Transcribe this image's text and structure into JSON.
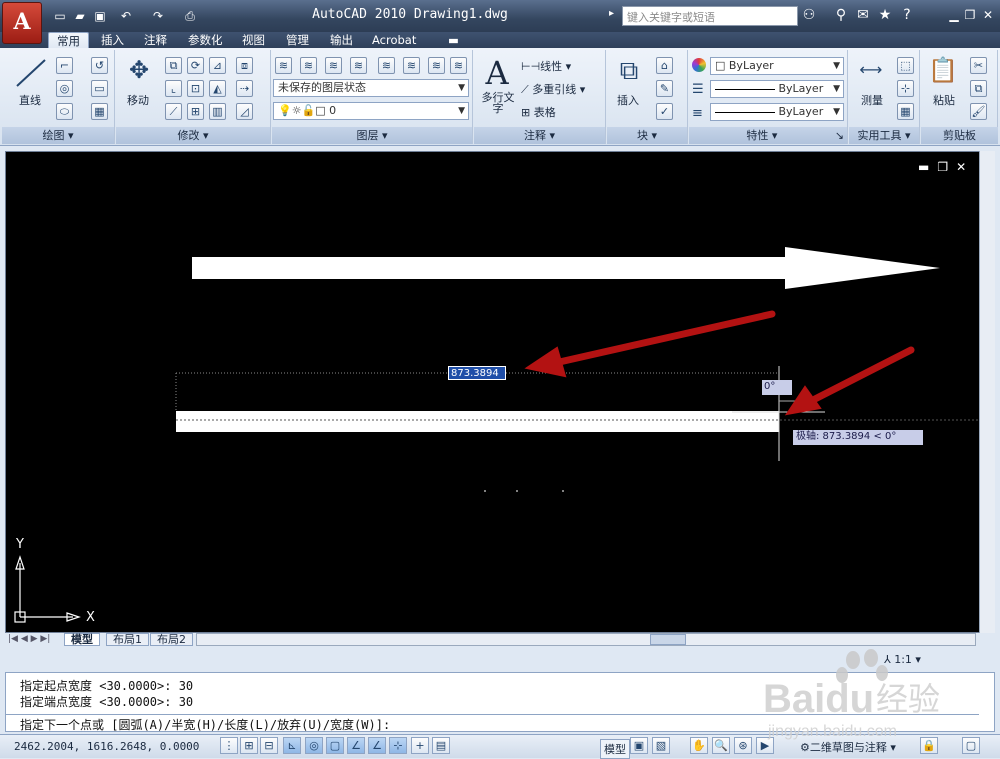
{
  "app": {
    "title": "AutoCAD 2010   Drawing1.dwg",
    "logo_letter": "A",
    "search_placeholder": "键入关键字或短语"
  },
  "tabs": [
    "常用",
    "插入",
    "注释",
    "参数化",
    "视图",
    "管理",
    "输出",
    "Acrobat"
  ],
  "active_tab": "常用",
  "ribbon": {
    "draw": {
      "title": "绘图",
      "line_label": "直线"
    },
    "modify": {
      "title": "修改",
      "move_label": "移动"
    },
    "layers": {
      "title": "图层",
      "layer_state": "未保存的图层状态",
      "current_layer": "0"
    },
    "annotation": {
      "title": "注释",
      "mtext_label": "多行文字",
      "linear": "线性",
      "mleader": "多重引线",
      "table": "表格"
    },
    "block": {
      "title": "块",
      "insert_label": "插入"
    },
    "properties": {
      "title": "特性",
      "color": "ByLayer",
      "linetype": "ByLayer",
      "lineweight": "ByLayer"
    },
    "utilities": {
      "title": "实用工具",
      "measure_label": "测量"
    },
    "clipboard": {
      "title": "剪贴板",
      "paste_label": "粘贴"
    }
  },
  "drawing": {
    "length_input": "873.3894",
    "angle_input": "0°",
    "polar_tooltip": "极轴: 873.3894 < 0°",
    "axis_y": "Y",
    "axis_x": "X"
  },
  "layout_tabs": [
    "模型",
    "布局1",
    "布局2"
  ],
  "command": {
    "history": [
      "指定起点宽度 <30.0000>: 30",
      "指定端点宽度 <30.0000>: 30"
    ],
    "prompt": "指定下一个点或 [圆弧(A)/半宽(H)/长度(L)/放弃(U)/宽度(W)]:"
  },
  "status": {
    "coordinates": "2462.2004, 1616.2648, 0.0000",
    "model_label": "模型",
    "scale": "1:1",
    "workspace": "二维草图与注释"
  },
  "colors": {
    "canvas": "#000000",
    "annotation_arrow": "#b31212",
    "input_box": "#1f4ea8",
    "tooltip_bg": "#c8cde8"
  },
  "watermark": {
    "brand": "Baidu",
    "suffix": "经验",
    "url": "jingyan.baidu.com"
  }
}
